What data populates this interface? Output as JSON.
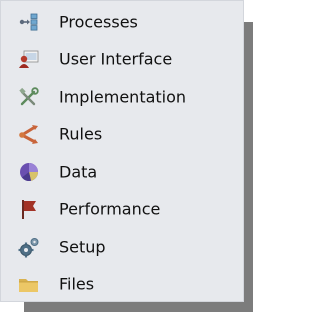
{
  "menu": {
    "items": [
      {
        "label": "Processes",
        "icon": "processes-icon"
      },
      {
        "label": "User Interface",
        "icon": "user-interface-icon"
      },
      {
        "label": "Implementation",
        "icon": "implementation-icon"
      },
      {
        "label": "Rules",
        "icon": "rules-icon"
      },
      {
        "label": "Data",
        "icon": "data-icon"
      },
      {
        "label": "Performance",
        "icon": "performance-icon"
      },
      {
        "label": "Setup",
        "icon": "setup-icon"
      },
      {
        "label": "Files",
        "icon": "files-icon"
      }
    ]
  },
  "colors": {
    "menu_background": "#e7e9ed",
    "shadow": "#7c7c7c",
    "text": "#111111"
  }
}
